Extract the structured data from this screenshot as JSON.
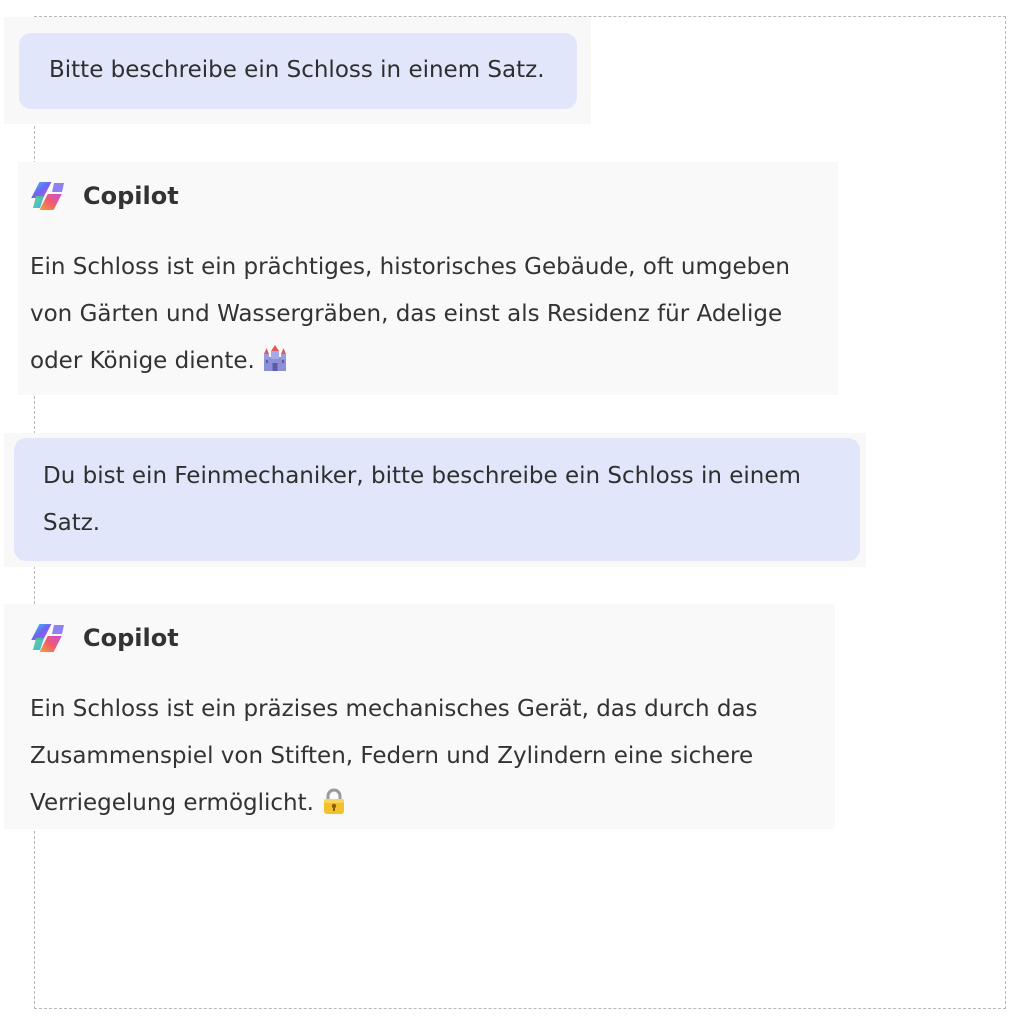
{
  "conversation": {
    "messages": [
      {
        "role": "user",
        "text": "Bitte beschreibe ein Schloss in einem Satz."
      },
      {
        "role": "assistant",
        "sender": "Copilot",
        "text": "Ein Schloss ist ein prächtiges, historisches Gebäude, oft umgeben von Gärten und Wassergräben, das einst als Residenz für Adelige oder Könige diente.",
        "emoji": "castle-emoji"
      },
      {
        "role": "user",
        "text": "Du bist ein Feinmechaniker, bitte beschreibe ein Schloss in einem Satz."
      },
      {
        "role": "assistant",
        "sender": "Copilot",
        "text": "Ein Schloss ist ein präzises mechanisches Gerät, das durch das Zusammenspiel von Stiften, Federn und Zylindern eine sichere Verriegelung ermöglicht.",
        "emoji": "lock-emoji"
      }
    ]
  },
  "colors": {
    "user_bubble": "#e2e6fb",
    "assistant_card": "#f9f9f9",
    "text": "#333333",
    "frame_border": "#b8b8b8"
  }
}
